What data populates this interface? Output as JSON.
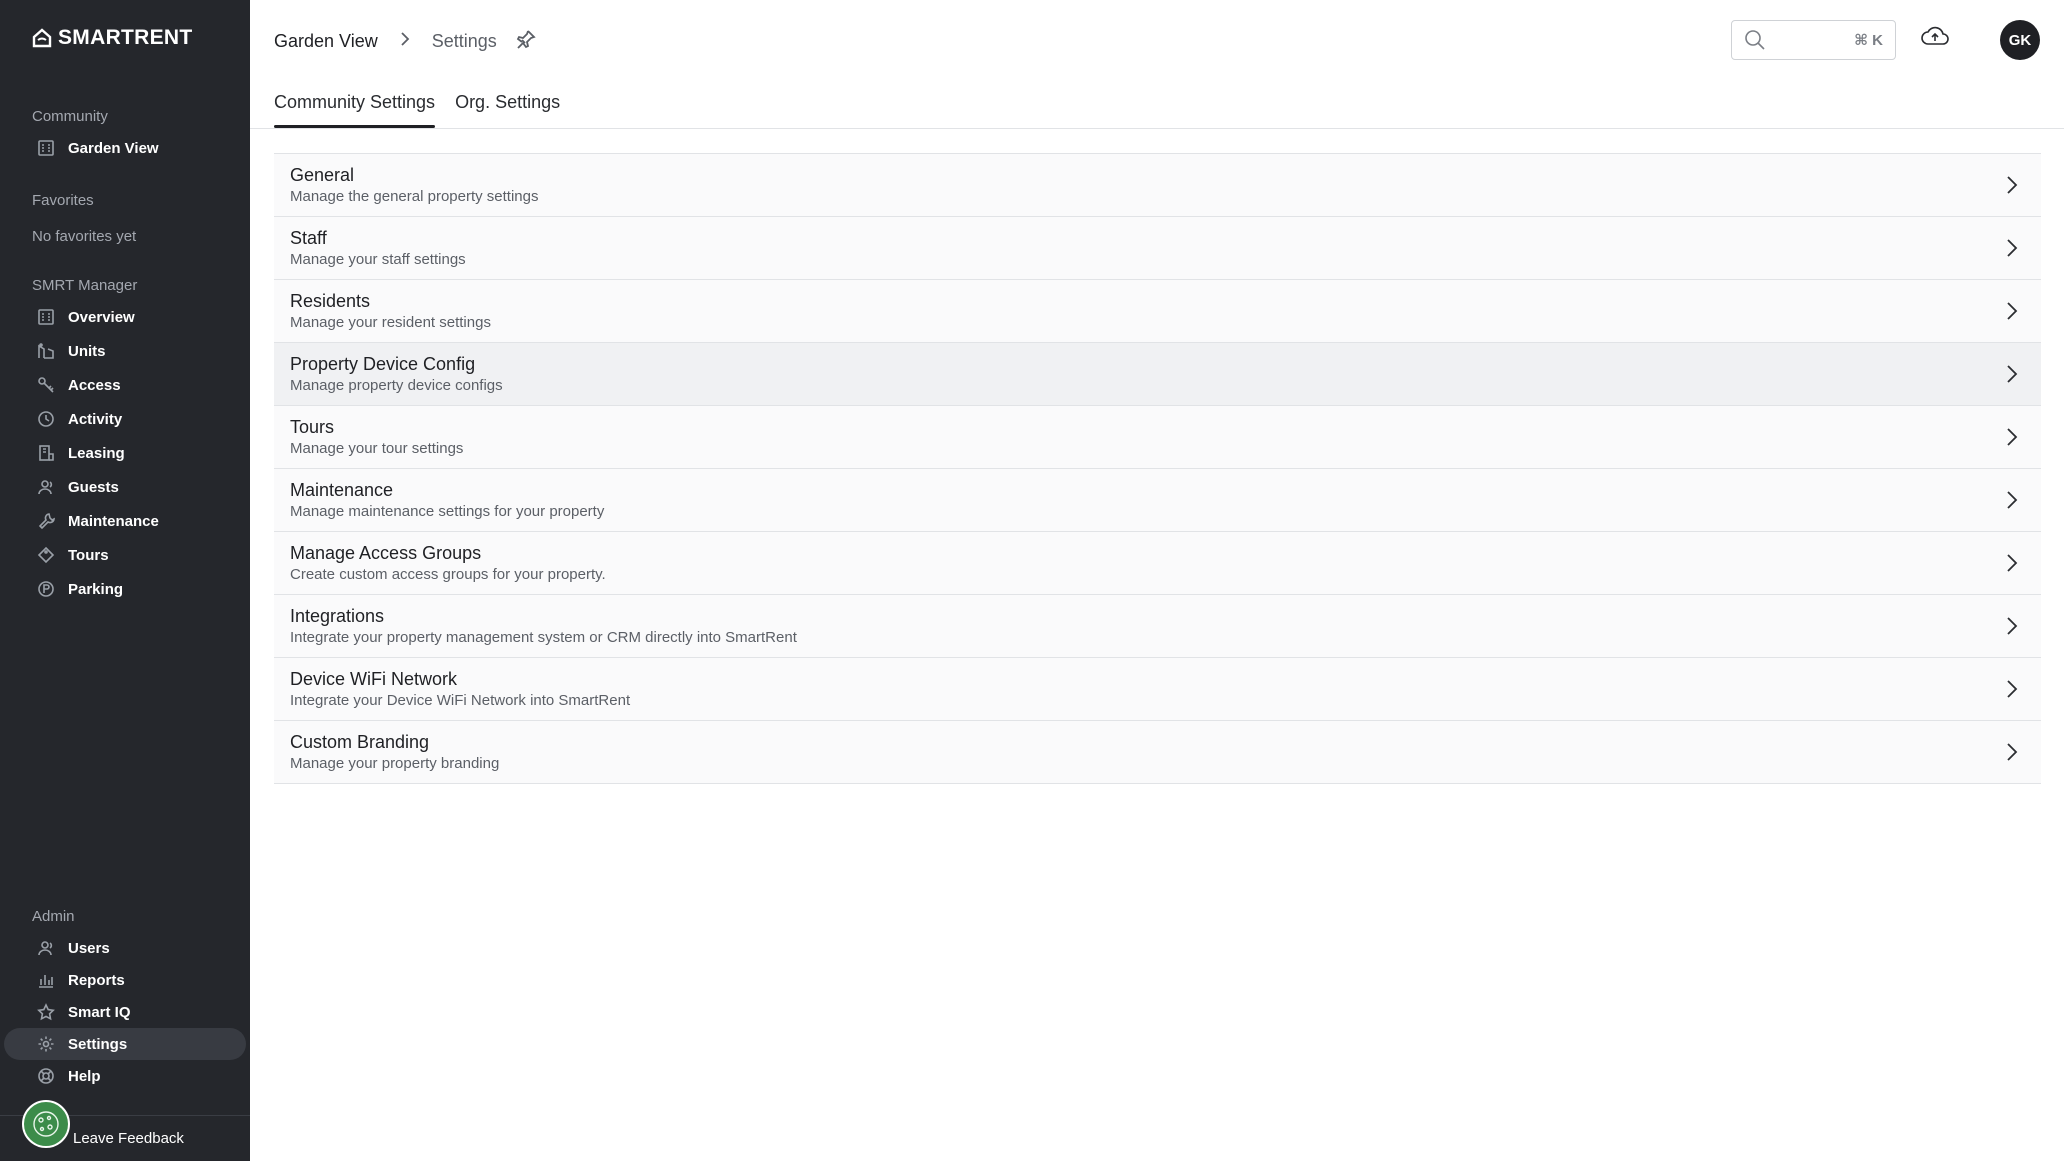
{
  "brand": {
    "name": "SMARTRENT"
  },
  "sidebar": {
    "community": {
      "label": "Community",
      "item": {
        "label": "Garden View",
        "icon": "building-icon"
      }
    },
    "favorites": {
      "label": "Favorites",
      "empty": "No favorites yet"
    },
    "manager": {
      "label": "SMRT Manager",
      "items": [
        {
          "label": "Overview",
          "icon": "building-icon"
        },
        {
          "label": "Units",
          "icon": "units-icon"
        },
        {
          "label": "Access",
          "icon": "key-icon"
        },
        {
          "label": "Activity",
          "icon": "clock-icon"
        },
        {
          "label": "Leasing",
          "icon": "leasing-icon"
        },
        {
          "label": "Guests",
          "icon": "guests-icon"
        },
        {
          "label": "Maintenance",
          "icon": "wrench-icon"
        },
        {
          "label": "Tours",
          "icon": "tag-icon"
        },
        {
          "label": "Parking",
          "icon": "parking-icon"
        }
      ]
    },
    "admin": {
      "label": "Admin",
      "items": [
        {
          "label": "Users",
          "icon": "users-icon"
        },
        {
          "label": "Reports",
          "icon": "chart-icon"
        },
        {
          "label": "Smart IQ",
          "icon": "star-icon"
        },
        {
          "label": "Settings",
          "icon": "gear-icon",
          "active": true
        },
        {
          "label": "Help",
          "icon": "lifebuoy-icon"
        }
      ]
    },
    "feedback": {
      "label": "Leave Feedback"
    }
  },
  "header": {
    "breadcrumb": [
      "Garden View",
      "Settings"
    ],
    "search": {
      "placeholder": "",
      "shortcut": "⌘ K"
    },
    "user_initials": "GK"
  },
  "tabs": [
    {
      "label": "Community Settings",
      "active": true
    },
    {
      "label": "Org. Settings",
      "active": false
    }
  ],
  "settings": [
    {
      "title": "General",
      "description": "Manage the general property settings"
    },
    {
      "title": "Staff",
      "description": "Manage your staff settings"
    },
    {
      "title": "Residents",
      "description": "Manage your resident settings"
    },
    {
      "title": "Property Device Config",
      "description": "Manage property device configs"
    },
    {
      "title": "Tours",
      "description": "Manage your tour settings"
    },
    {
      "title": "Maintenance",
      "description": "Manage maintenance settings for your property"
    },
    {
      "title": "Manage Access Groups",
      "description": "Create custom access groups for your property."
    },
    {
      "title": "Integrations",
      "description": "Integrate your property management system or CRM directly into SmartRent"
    },
    {
      "title": "Device WiFi Network",
      "description": "Integrate your Device WiFi Network into SmartRent"
    },
    {
      "title": "Custom Branding",
      "description": "Manage your property branding"
    }
  ]
}
